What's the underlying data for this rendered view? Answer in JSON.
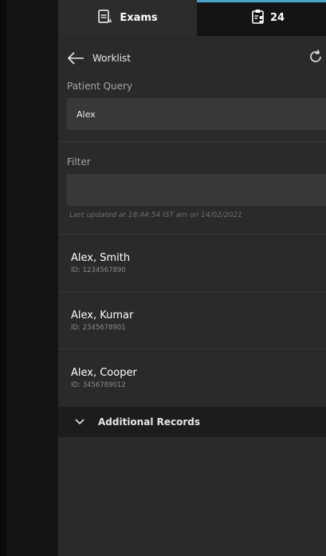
{
  "tabs": {
    "exams_label": "Exams",
    "count_label": "24",
    "accent_color": "#4aa3c8",
    "exams_icon": "exams-scan-icon",
    "count_icon": "clipboard-user-icon"
  },
  "header": {
    "back_label": "Worklist",
    "back_icon": "arrow-left-icon",
    "refresh_icon": "refresh-icon"
  },
  "query": {
    "label": "Patient Query",
    "value": "Alex"
  },
  "filter": {
    "label": "Filter",
    "value": "",
    "last_updated": "Last updated at 18:44:54 IST am on 14/02/2021"
  },
  "patients": [
    {
      "name": "Alex, Smith",
      "id": "ID: 1234567890"
    },
    {
      "name": "Alex, Kumar",
      "id": "ID: 2345678901"
    },
    {
      "name": "Alex, Cooper",
      "id": "ID: 3456789012"
    }
  ],
  "additional": {
    "label": "Additional Records",
    "icon": "chevron-down-icon"
  }
}
